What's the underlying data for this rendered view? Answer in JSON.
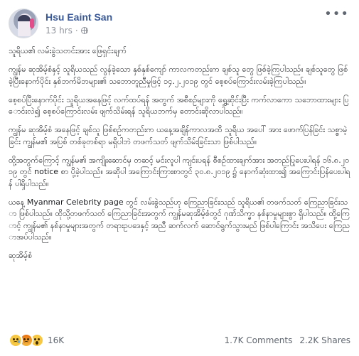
{
  "post": {
    "author": "Hsu Eaint San",
    "time": "13 hrs",
    "separator": "·",
    "more_label": "•••",
    "paragraphs": [
      "သူရိယ၏ လမ်းခွဲသတင်းအား ဖြေရှင်းချက်",
      "ကျွန်မ ဆုအိမ့်စံနှင့် သူရိယသည် လွန်ခဲ့သော နှစ်နှစ်ကျော် ကာလကတည်းက ချစ်သူ တွေ ဖြစ်ခဲ့ကြပါသည်။ ချစ်သူတွေ ဖြစ်ခဲ့ပြီးနောက်ပိုင်း နှစ်ဘက်မိဘများ၏ သဘောတူညီမှုဖြင့် ၁၄.၂.၂၀၁၉ တွင် စေ့စပ်ကြောင်းလမ်းခဲ့ကြပါသည်။",
      "စေ့စပ်ပြီးနောက်ပိုင်း သူရိယအနေဖြင့် လက်ထပ်ရန် အတွက် အစီစဉ်များကို ရွှေ့ဆိုင်းပြီး ကက်လာကော သဘောထားများ ပြောင်းလဲ၍ စေ့စပ်ကြောင်းလမ်း ဖျက်သိမ်းရန် သူရိယဘက်မှ တောင်းဆိုလာပါသည်။",
      "ကျွန်မ ဆုအိမ့်စံ အနေဖြင့် ချစ်သူ ဖြစ်စဉ်ကတည်းက ယနေ့အချိန်ကာလအထိ သူရိယ အပေါ် အား ဖောက်ပြန်ခြင်း သစ္စာမဲ့ခြင်း ကျွန်မ၏ အပြစ် တစ်ခုတစ်ရာ မရှိပါဘဲ တဖက်သတ် ဖျက်သိမ်းခြင်းသာ ဖြစ်ပါသည်။",
      "ထို့အတွက်ကြောင့် ကျွန်မ၏ အကျိုးဆောင်မှ တဆင့် မင်းလူပါ ကျင်းပရန် စီစဉ်ထားချက်အား အတည်ပြုပေးပါရန် ၁၆.၈.၂၀၁၉ တွင် notice စာ ပို့ခဲ့ပါသည်။ အဆိုပါ အကြောင်းကြားစာတွင် ၃၀.၈.၂၀၁၉ ၌ နောက်ဆုံးထား၍ အကြောင်းပြန်ပေးပါရန် ပါရှိပါသည်။",
      "ယနေ့ Myanmar Celebrity page တွင် လမ်းခွဲသည်ဟု ကြေညာခြင်းသည် သူရိယ၏ တဖက်သတ် ကြေညာခြင်းသာ ဖြစ်ပါသည်။ ထိုသို့တဖက်သတ် ကြေညာခြင်းအတွက် ကျွန်မဆုအိမ့်စံတွင် ဂုဏ်သိက္ခာ နစ်နာမှုများစွာ ရှိပါသည်။ ထို့ကြောင့် ကျွန်မ၏ နစ်နာမှုများအတွက် တရားဥပဒေနှင့် အညီ ဆက်လက် ဆောင်ရွက်သွားမည် ဖြစ်ပါကြောင်း အသိပေး ကြေညာအပ်ပါသည်။",
      "ဆုအိမ့်စံ"
    ]
  },
  "footer": {
    "reaction_count": "16K",
    "comments": "1.7K Comments",
    "shares": "2.2K Shares"
  },
  "icons": [
    "avatar",
    "globe-icon",
    "sad-reaction-icon",
    "angry-reaction-icon",
    "wow-reaction-icon",
    "more-options-icon"
  ],
  "colors": {
    "name": "#385898",
    "meta": "#90949c",
    "text": "#1c1e21"
  }
}
